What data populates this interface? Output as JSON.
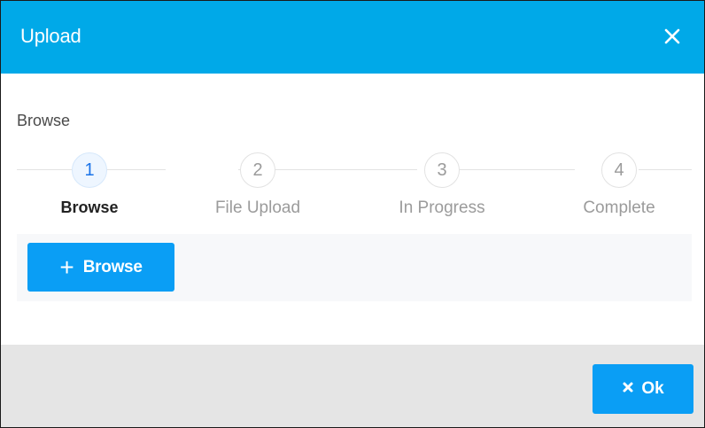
{
  "dialog": {
    "title": "Upload",
    "close_icon": "close-icon"
  },
  "section_label": "Browse",
  "stepper": {
    "active_index": 0,
    "steps": [
      {
        "number": "1",
        "label": "Browse"
      },
      {
        "number": "2",
        "label": "File Upload"
      },
      {
        "number": "3",
        "label": "In Progress"
      },
      {
        "number": "4",
        "label": "Complete"
      }
    ]
  },
  "browse_button": {
    "icon": "plus-icon",
    "label": "Browse"
  },
  "footer": {
    "ok_button": {
      "icon": "x-icon",
      "label": "Ok"
    }
  },
  "colors": {
    "header": "#00a9e8",
    "button": "#0a9ef5",
    "footer": "#e5e5e5",
    "active_step": "#1a73e8"
  }
}
